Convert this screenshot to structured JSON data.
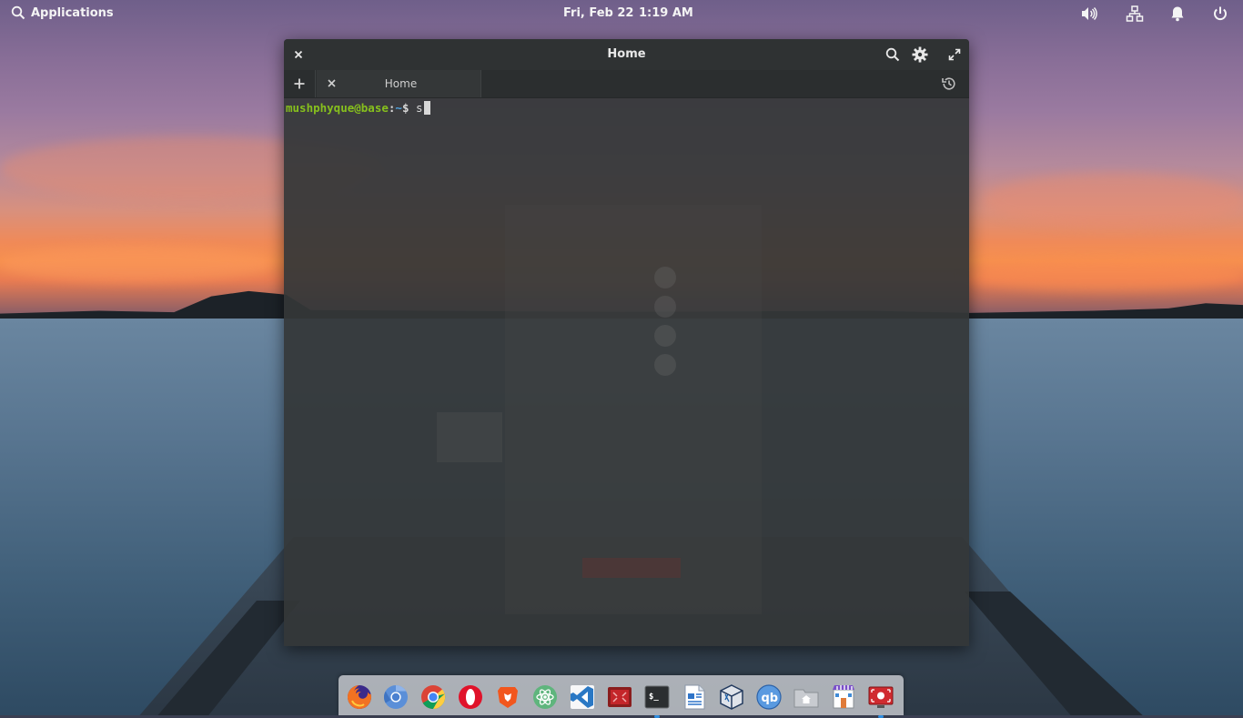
{
  "panel": {
    "applications_label": "Applications",
    "date": "Fri, Feb 22",
    "time": "1:19 AM",
    "indicators": [
      "sound-icon",
      "network-icon",
      "notifications-icon",
      "power-icon"
    ]
  },
  "terminal": {
    "window_title": "Home",
    "tab_label": "Home",
    "prompt_user_host": "mushphyque@base",
    "prompt_colon": ":",
    "prompt_path": "~",
    "prompt_dollar": "$ ",
    "command_text": "s",
    "colors": {
      "user_host": "#87c01d",
      "path": "#4ea3e0",
      "background": "#343738"
    }
  },
  "dock": {
    "items": [
      {
        "icon": "firefox-icon",
        "running": false
      },
      {
        "icon": "chromium-icon",
        "running": false
      },
      {
        "icon": "chrome-icon",
        "running": false
      },
      {
        "icon": "opera-icon",
        "running": false
      },
      {
        "icon": "brave-icon",
        "running": false
      },
      {
        "icon": "atom-icon",
        "running": false
      },
      {
        "icon": "vscode-icon",
        "running": false
      },
      {
        "icon": "screen-recorder-icon",
        "running": false
      },
      {
        "icon": "terminal-icon",
        "running": true
      },
      {
        "icon": "text-editor-icon",
        "running": false
      },
      {
        "icon": "virtualbox-icon",
        "running": false
      },
      {
        "icon": "qbittorrent-icon",
        "running": false
      },
      {
        "icon": "files-icon",
        "running": false
      },
      {
        "icon": "appcenter-icon",
        "running": false
      },
      {
        "icon": "screencast-icon",
        "running": true
      }
    ]
  }
}
